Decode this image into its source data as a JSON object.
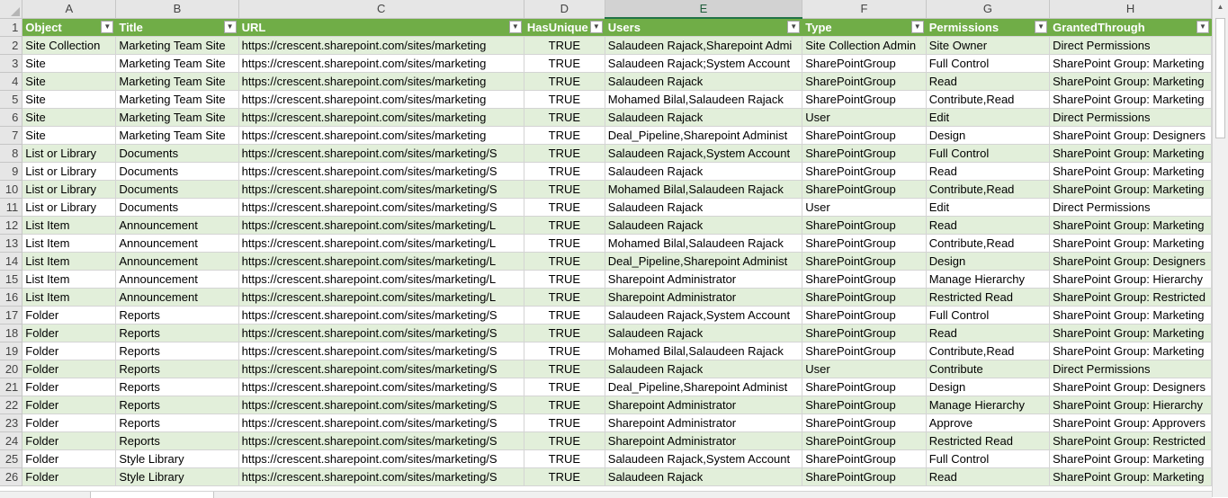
{
  "columns": [
    "A",
    "B",
    "C",
    "D",
    "E",
    "F",
    "G",
    "H"
  ],
  "selected_column": "E",
  "header_row_number": "1",
  "headers": [
    "Object",
    "Title",
    "URL",
    "HasUnique",
    "Users",
    "Type",
    "Permissions",
    "GrantedThrough"
  ],
  "active_cell": {
    "row": 25,
    "col": 4
  },
  "filter_icon": "dropdown-arrow-icon",
  "colors": {
    "header_fill": "#70ad47",
    "band_fill": "#e2efda",
    "selection": "#217346"
  },
  "rows": [
    [
      "2",
      "Site Collection",
      "Marketing Team Site",
      "https://crescent.sharepoint.com/sites/marketing",
      "TRUE",
      "Salaudeen Rajack,Sharepoint Admi",
      "Site Collection Admin",
      "Site Owner",
      "Direct Permissions"
    ],
    [
      "3",
      "Site",
      "Marketing Team Site",
      "https://crescent.sharepoint.com/sites/marketing",
      "TRUE",
      "Salaudeen Rajack;System Account",
      "SharePointGroup",
      "Full Control",
      "SharePoint Group: Marketing"
    ],
    [
      "4",
      "Site",
      "Marketing Team Site",
      "https://crescent.sharepoint.com/sites/marketing",
      "TRUE",
      "Salaudeen Rajack",
      "SharePointGroup",
      "Read",
      "SharePoint Group: Marketing"
    ],
    [
      "5",
      "Site",
      "Marketing Team Site",
      "https://crescent.sharepoint.com/sites/marketing",
      "TRUE",
      "Mohamed Bilal,Salaudeen Rajack",
      "SharePointGroup",
      "Contribute,Read",
      "SharePoint Group: Marketing"
    ],
    [
      "6",
      "Site",
      "Marketing Team Site",
      "https://crescent.sharepoint.com/sites/marketing",
      "TRUE",
      "Salaudeen Rajack",
      "User",
      "Edit",
      "Direct Permissions"
    ],
    [
      "7",
      "Site",
      "Marketing Team Site",
      "https://crescent.sharepoint.com/sites/marketing",
      "TRUE",
      "Deal_Pipeline,Sharepoint Administ",
      "SharePointGroup",
      "Design",
      "SharePoint Group: Designers"
    ],
    [
      "8",
      "List or Library",
      "Documents",
      "https://crescent.sharepoint.com/sites/marketing/S",
      "TRUE",
      "Salaudeen Rajack,System Account",
      "SharePointGroup",
      "Full Control",
      "SharePoint Group: Marketing"
    ],
    [
      "9",
      "List or Library",
      "Documents",
      "https://crescent.sharepoint.com/sites/marketing/S",
      "TRUE",
      "Salaudeen Rajack",
      "SharePointGroup",
      "Read",
      "SharePoint Group: Marketing"
    ],
    [
      "10",
      "List or Library",
      "Documents",
      "https://crescent.sharepoint.com/sites/marketing/S",
      "TRUE",
      "Mohamed Bilal,Salaudeen Rajack",
      "SharePointGroup",
      "Contribute,Read",
      "SharePoint Group: Marketing"
    ],
    [
      "11",
      "List or Library",
      "Documents",
      "https://crescent.sharepoint.com/sites/marketing/S",
      "TRUE",
      "Salaudeen Rajack",
      "User",
      "Edit",
      "Direct Permissions"
    ],
    [
      "12",
      "List Item",
      "Announcement",
      "https://crescent.sharepoint.com/sites/marketing/L",
      "TRUE",
      "Salaudeen Rajack",
      "SharePointGroup",
      "Read",
      "SharePoint Group: Marketing"
    ],
    [
      "13",
      "List Item",
      "Announcement",
      "https://crescent.sharepoint.com/sites/marketing/L",
      "TRUE",
      "Mohamed Bilal,Salaudeen Rajack",
      "SharePointGroup",
      "Contribute,Read",
      "SharePoint Group: Marketing"
    ],
    [
      "14",
      "List Item",
      "Announcement",
      "https://crescent.sharepoint.com/sites/marketing/L",
      "TRUE",
      "Deal_Pipeline,Sharepoint Administ",
      "SharePointGroup",
      "Design",
      "SharePoint Group: Designers"
    ],
    [
      "15",
      "List Item",
      "Announcement",
      "https://crescent.sharepoint.com/sites/marketing/L",
      "TRUE",
      "Sharepoint Administrator",
      "SharePointGroup",
      "Manage Hierarchy",
      "SharePoint Group: Hierarchy"
    ],
    [
      "16",
      "List Item",
      "Announcement",
      "https://crescent.sharepoint.com/sites/marketing/L",
      "TRUE",
      "Sharepoint Administrator",
      "SharePointGroup",
      "Restricted Read",
      "SharePoint Group: Restricted"
    ],
    [
      "17",
      "Folder",
      "Reports",
      "https://crescent.sharepoint.com/sites/marketing/S",
      "TRUE",
      "Salaudeen Rajack,System Account",
      "SharePointGroup",
      "Full Control",
      "SharePoint Group: Marketing"
    ],
    [
      "18",
      "Folder",
      "Reports",
      "https://crescent.sharepoint.com/sites/marketing/S",
      "TRUE",
      "Salaudeen Rajack",
      "SharePointGroup",
      "Read",
      "SharePoint Group: Marketing"
    ],
    [
      "19",
      "Folder",
      "Reports",
      "https://crescent.sharepoint.com/sites/marketing/S",
      "TRUE",
      "Mohamed Bilal,Salaudeen Rajack",
      "SharePointGroup",
      "Contribute,Read",
      "SharePoint Group: Marketing"
    ],
    [
      "20",
      "Folder",
      "Reports",
      "https://crescent.sharepoint.com/sites/marketing/S",
      "TRUE",
      "Salaudeen Rajack",
      "User",
      "Contribute",
      "Direct Permissions"
    ],
    [
      "21",
      "Folder",
      "Reports",
      "https://crescent.sharepoint.com/sites/marketing/S",
      "TRUE",
      "Deal_Pipeline,Sharepoint Administ",
      "SharePointGroup",
      "Design",
      "SharePoint Group: Designers"
    ],
    [
      "22",
      "Folder",
      "Reports",
      "https://crescent.sharepoint.com/sites/marketing/S",
      "TRUE",
      "Sharepoint Administrator",
      "SharePointGroup",
      "Manage Hierarchy",
      "SharePoint Group: Hierarchy"
    ],
    [
      "23",
      "Folder",
      "Reports",
      "https://crescent.sharepoint.com/sites/marketing/S",
      "TRUE",
      "Sharepoint Administrator",
      "SharePointGroup",
      "Approve",
      "SharePoint Group: Approvers"
    ],
    [
      "24",
      "Folder",
      "Reports",
      "https://crescent.sharepoint.com/sites/marketing/S",
      "TRUE",
      "Sharepoint Administrator",
      "SharePointGroup",
      "Restricted Read",
      "SharePoint Group: Restricted"
    ],
    [
      "25",
      "Folder",
      "Style Library",
      "https://crescent.sharepoint.com/sites/marketing/S",
      "TRUE",
      "Salaudeen Rajack,System Account",
      "SharePointGroup",
      "Full Control",
      "SharePoint Group: Marketing"
    ],
    [
      "26",
      "Folder",
      "Style Library",
      "https://crescent.sharepoint.com/sites/marketing/S",
      "TRUE",
      "Salaudeen Rajack",
      "SharePointGroup",
      "Read",
      "SharePoint Group: Marketing"
    ]
  ]
}
